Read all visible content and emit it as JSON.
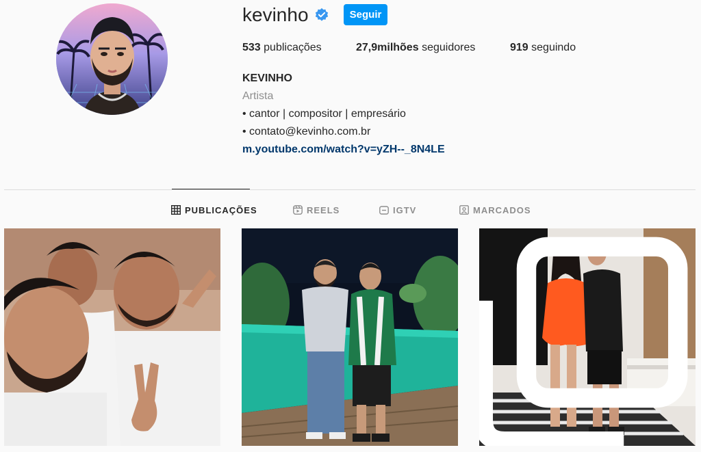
{
  "profile": {
    "username": "kevinho",
    "verified": true,
    "follow_label": "Seguir",
    "stats": {
      "posts_count": "533",
      "posts_label": "publicações",
      "followers_count": "27,9milhões",
      "followers_label": "seguidores",
      "following_count": "919",
      "following_label": "seguindo"
    },
    "bio": {
      "name": "KEVINHO",
      "category": "Artista",
      "line1": "• cantor | compositor | empresário",
      "line2": "• contato@kevinho.com.br",
      "link": "m.youtube.com/watch?v=yZH--_8N4LE"
    }
  },
  "tabs": [
    {
      "label": "PUBLICAÇÕES",
      "icon": "grid-icon",
      "active": true
    },
    {
      "label": "REELS",
      "icon": "reels-icon",
      "active": false
    },
    {
      "label": "IGTV",
      "icon": "igtv-icon",
      "active": false
    },
    {
      "label": "MARCADOS",
      "icon": "tagged-icon",
      "active": false
    }
  ],
  "colors": {
    "follow_button": "#0095f6",
    "verified_badge": "#3897f0",
    "link": "#00376b",
    "background": "#fafafa"
  },
  "posts": [
    {
      "icon": "photo",
      "multi": false
    },
    {
      "icon": "photo",
      "multi": false
    },
    {
      "icon": "photo",
      "multi": true
    }
  ]
}
